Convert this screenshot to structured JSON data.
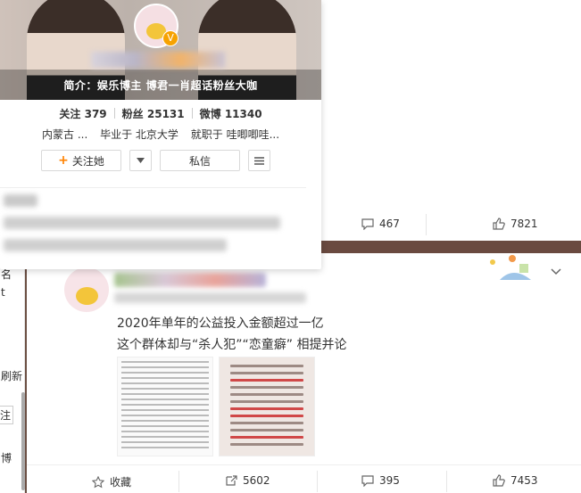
{
  "profile_card": {
    "intro": "简介：娱乐博主 博君一肖超话粉丝大咖",
    "stats": {
      "follow_label": "关注",
      "follow_count": "379",
      "fans_label": "粉丝",
      "fans_count": "25131",
      "weibo_label": "微博",
      "weibo_count": "11340"
    },
    "location": "内蒙古 ...",
    "school": "毕业于 北京大学",
    "work": "就职于 哇唧唧哇...",
    "follow_button": "关注她",
    "message_button": "私信",
    "vip_badge": "V"
  },
  "prev_post_actions": {
    "comments": "467",
    "likes": "7821"
  },
  "post": {
    "line1": "2020年单年的公益投入金额超过一亿",
    "line2": "这个群体却与“杀人犯”“恋童癖” 相提并论",
    "image2_lines": [
      "截止到2020年12月1日，",
      "肖战粉丝今年参与并支持",
      "超过260项公益项目（不完全统计）",
      "公益投入金额已超过9810万人民币，",
      "在“肖战粉丝公益项目组”",
      "累计超过790万人民币",
      "累计超过260万人次参与。"
    ],
    "actions": {
      "collect": "收藏",
      "repost": "5602",
      "comments": "395",
      "likes": "7453"
    }
  },
  "left_strip": {
    "chars": [
      "名",
      "t",
      "刷新",
      "注",
      "博"
    ]
  },
  "colors": {
    "accent_orange": "#ff8200",
    "text": "#333333",
    "vip": "#f6a200"
  },
  "icons": [
    "plus-icon",
    "chevron-down-icon",
    "menu-icon",
    "comment-icon",
    "like-icon",
    "star-icon",
    "repost-icon"
  ]
}
